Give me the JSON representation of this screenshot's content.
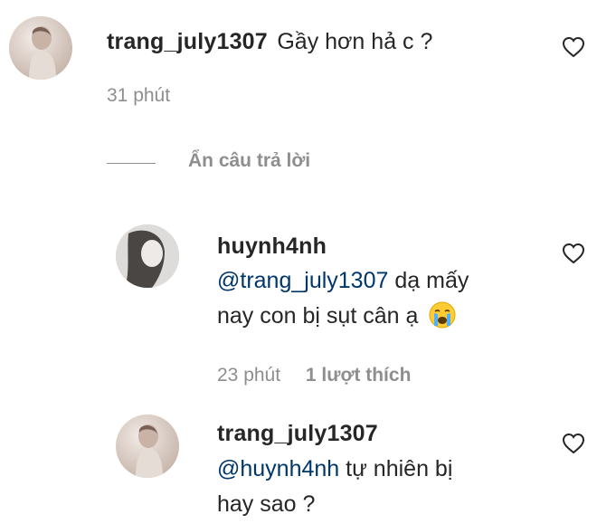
{
  "comment": {
    "username": "trang_july1307",
    "text": "Gầy hơn hả c ?",
    "time": "31 phút"
  },
  "hide_replies_label": "Ẩn câu trả lời",
  "replies": [
    {
      "username": "huynh4nh",
      "mention": "@trang_july1307",
      "text_line1": "dạ mấy",
      "text_line2": "nay con bị sụt cân ạ",
      "emoji": "crying-face-emoji",
      "time": "23 phút",
      "likes": "1 lượt thích"
    },
    {
      "username": "trang_july1307",
      "mention": "@huynh4nh",
      "text_line1": "tự nhiên bị",
      "text_line2": "hay sao ?"
    }
  ],
  "colors": {
    "text": "#262626",
    "mention": "#00376b",
    "meta": "#8e8e8e"
  }
}
